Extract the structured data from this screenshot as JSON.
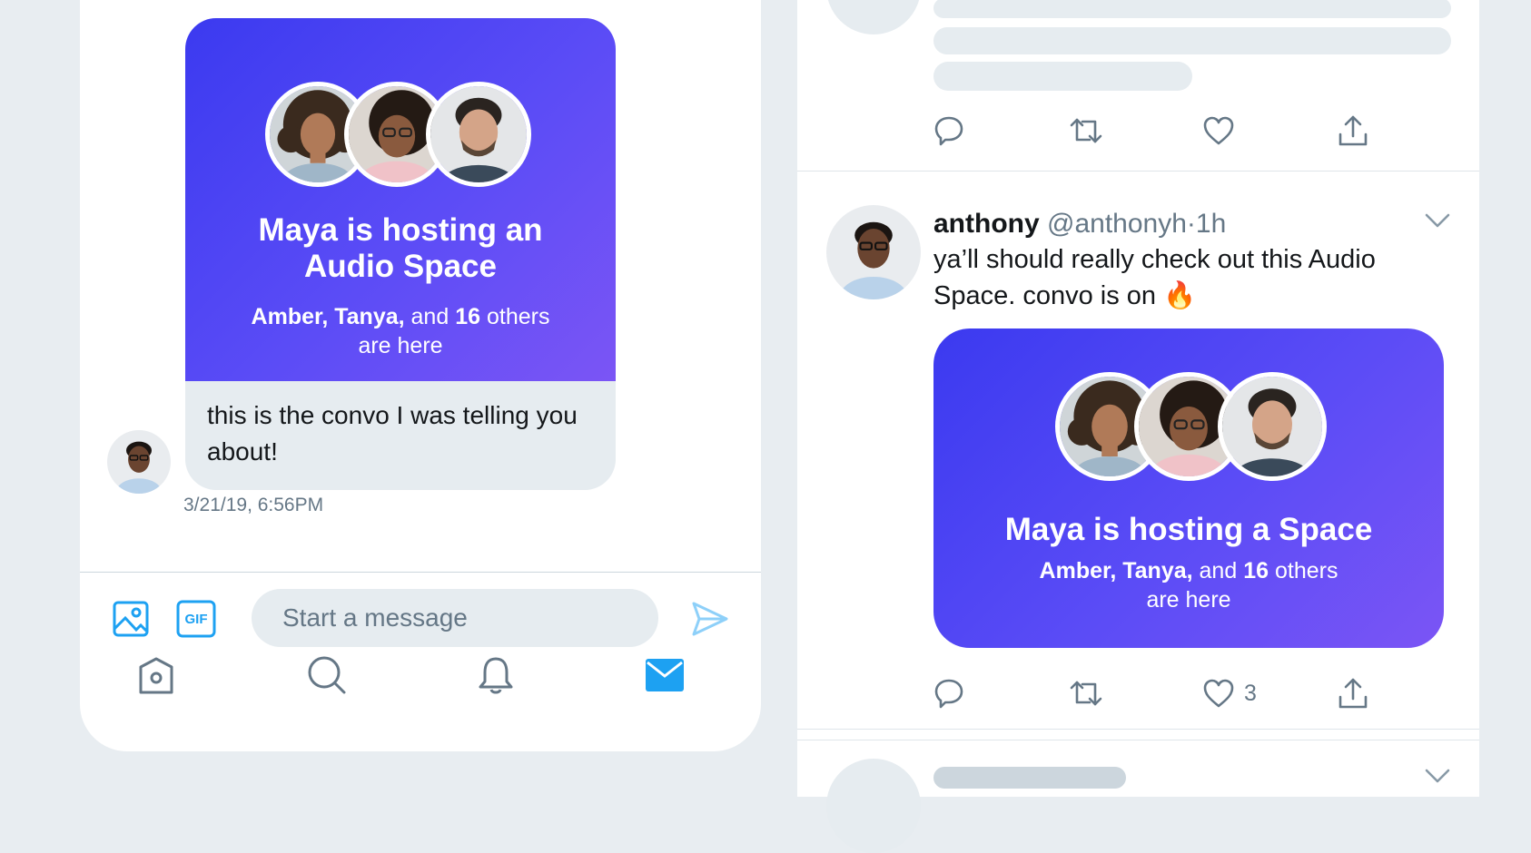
{
  "dm": {
    "space_card": {
      "title": "Maya is hosting an Audio Space",
      "names": "Amber, Tanya,",
      "and": "and",
      "count": "16",
      "others": "others",
      "are_here": "are here"
    },
    "message": "this is the convo I was telling you about!",
    "timestamp": "3/21/19, 6:56PM",
    "composer": {
      "placeholder": "Start a message",
      "gif_label": "GIF"
    },
    "nav": [
      "home-icon",
      "search-icon",
      "notifications-icon",
      "messages-icon"
    ]
  },
  "timeline": {
    "tweet": {
      "name": "anthony",
      "handle": "@anthonyh",
      "separator": "·",
      "time": "1h",
      "text": "ya’ll should really check out this Audio Space. convo is on 🔥",
      "space_card": {
        "title": "Maya is hosting a Space",
        "names": "Amber, Tanya,",
        "and": "and",
        "count": "16",
        "others": "others",
        "are_here": "are here"
      },
      "like_count": "3"
    }
  },
  "colors": {
    "accent": "#1da1f2",
    "card_gradient_start": "#3b3af0",
    "card_gradient_end": "#7b55f5",
    "muted_text": "#657786",
    "bubble": "#e6ecf0"
  }
}
